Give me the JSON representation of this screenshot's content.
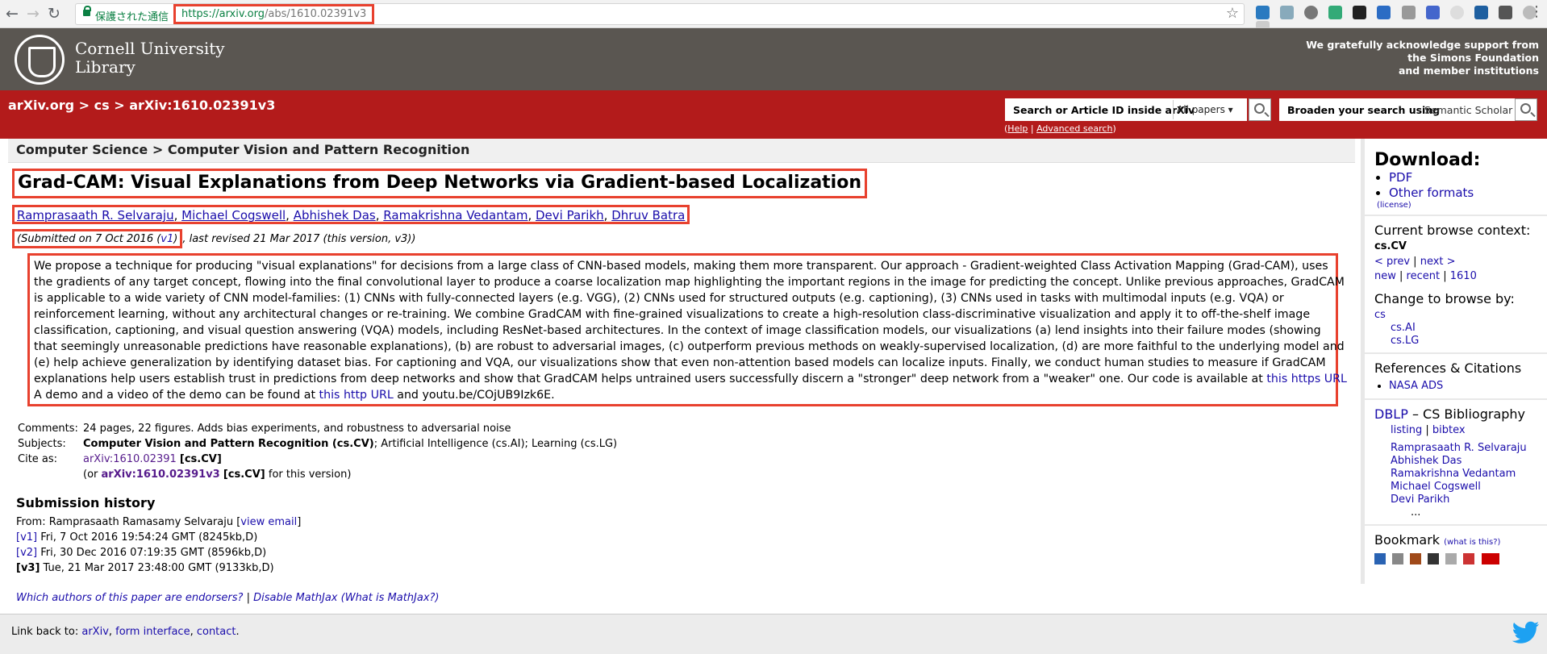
{
  "browser": {
    "secure_label": "保護された通信",
    "url_main": "https://arxiv.org",
    "url_rest": "/abs/1610.02391v3"
  },
  "header": {
    "org_line1": "Cornell University",
    "org_line2": "Library",
    "ack_line1": "We gratefully acknowledge support from",
    "ack_line2": "the Simons Foundation",
    "ack_line3": "and member institutions"
  },
  "breadcrumb": {
    "site": "arXiv.org",
    "sep": ">",
    "cat": "cs",
    "id": "arXiv:1610.02391v3"
  },
  "search": {
    "label": "Search or Article ID inside arXiv",
    "scope": "All papers",
    "broaden_label": "Broaden your search using",
    "broaden_value": "Semantic Scholar",
    "help": "Help",
    "advanced": "Advanced search"
  },
  "subject_header": "Computer Science > Computer Vision and Pattern Recognition",
  "paper": {
    "title": "Grad-CAM: Visual Explanations from Deep Networks via Gradient-based Localization",
    "authors": [
      "Ramprasaath R. Selvaraju",
      "Michael Cogswell",
      "Abhishek Das",
      "Ramakrishna Vedantam",
      "Devi Parikh",
      "Dhruv Batra"
    ],
    "submitted_prefix": "(Submitted on 7 Oct 2016 (",
    "submitted_link": "v1",
    "submitted_suffix": ")",
    "revised": ", last revised 21 Mar 2017 (this version, v3))",
    "abstract_lines": [
      "We propose a technique for producing \"visual explanations\" for decisions from a large class of CNN-based models, making them more transparent. Our approach - Gradient-weighted Class Activation Mapping (Grad-CAM), uses",
      "the gradients of any target concept, flowing into the final convolutional layer to produce a coarse localization map highlighting the important regions in the image for predicting the concept. Unlike previous approaches, GradCAM",
      "is applicable to a wide variety of CNN model-families: (1) CNNs with fully-connected layers (e.g. VGG), (2) CNNs used for structured outputs (e.g. captioning), (3) CNNs used in tasks with multimodal inputs (e.g. VQA) or",
      "reinforcement learning, without any architectural changes or re-training. We combine GradCAM with fine-grained visualizations to create a high-resolution class-discriminative visualization and apply it to off-the-shelf image",
      "classification, captioning, and visual question answering (VQA) models, including ResNet-based architectures. In the context of image classification models, our visualizations (a) lend insights into their failure modes (showing",
      "that seemingly unreasonable predictions have reasonable explanations), (b) are robust to adversarial images, (c) outperform previous methods on weakly-supervised localization, (d) are more faithful to the underlying model and",
      "(e) help achieve generalization by identifying dataset bias. For captioning and VQA, our visualizations show that even non-attention based models can localize inputs. Finally, we conduct human studies to measure if GradCAM",
      "explanations help users establish trust in predictions from deep networks and show that GradCAM helps untrained users successfully discern a \"stronger\" deep network from a \"weaker\" one. Our code is available at"
    ],
    "abstract_link1": "this https URL",
    "abstract_last_prefix": "A demo and a video of the demo can be found at",
    "abstract_link2": "this http URL",
    "abstract_last_suffix": "and youtu.be/COjUB9Izk6E.",
    "comments_label": "Comments:",
    "comments": "24 pages, 22 figures. Adds bias experiments, and robustness to adversarial noise",
    "subjects_label": "Subjects:",
    "subjects_primary": "Computer Vision and Pattern Recognition (cs.CV)",
    "subjects_rest": "; Artificial Intelligence (cs.AI); Learning (cs.LG)",
    "cite_label": "Cite as:",
    "cite_id": "arXiv:1610.02391",
    "cite_cat": "[cs.CV]",
    "cite2_prefix": "(or",
    "cite2_id": "arXiv:1610.02391v3",
    "cite2_cat": "[cs.CV]",
    "cite2_suffix": "for this version)"
  },
  "history": {
    "heading": "Submission history",
    "from_prefix": "From: Ramprasaath Ramasamy Selvaraju [",
    "view_email": "view email",
    "from_suffix": "]",
    "versions": [
      {
        "tag": "[v1]",
        "text": "Fri, 7 Oct 2016 19:54:24 GMT (8245kb,D)"
      },
      {
        "tag": "[v2]",
        "text": "Fri, 30 Dec 2016 07:19:35 GMT (8596kb,D)"
      },
      {
        "tag": "[v3]",
        "text": "Tue, 21 Mar 2017 23:48:00 GMT (9133kb,D)"
      }
    ]
  },
  "endorse": {
    "q": "Which authors of this paper are endorsers?",
    "sep": "|",
    "disable": "Disable MathJax",
    "what": "(What is MathJax?)"
  },
  "sidebar": {
    "download_title": "Download:",
    "pdf": "PDF",
    "other_formats": "Other formats",
    "license": "(license)",
    "context_title": "Current browse context:",
    "context": "cs.CV",
    "prev": "< prev",
    "next": "next >",
    "sep": "|",
    "new": "new",
    "recent": "recent",
    "month": "1610",
    "change_title": "Change to browse by:",
    "cs": "cs",
    "cs_ai": "cs.AI",
    "cs_lg": "cs.LG",
    "refs_title": "References & Citations",
    "nasa": "NASA ADS",
    "dblp": "DBLP",
    "dblp_rest": "– CS Bibliography",
    "listing": "listing",
    "bibtex": "bibtex",
    "dblp_authors": [
      "Ramprasaath R. Selvaraju",
      "Abhishek Das",
      "Ramakrishna Vedantam",
      "Michael Cogswell",
      "Devi Parikh"
    ],
    "ellipsis": "...",
    "bookmark_title": "Bookmark",
    "what_is_this": "(what is this?)"
  },
  "footer": {
    "prefix": "Link back to:",
    "arxiv": "arXiv",
    "form": "form interface",
    "contact": "contact"
  },
  "colors": {
    "brand_red": "#b31b1b",
    "cornell_gray": "#5a5651",
    "annotation_red": "#e8412e"
  }
}
